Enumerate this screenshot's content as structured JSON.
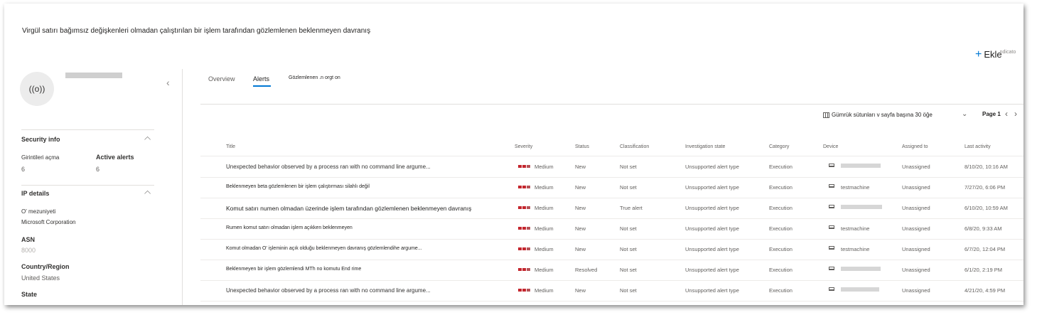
{
  "page": {
    "title": "Virgül satırı bağımsız değişkenleri olmadan çalıştırılan bir işlem tarafından gözlemlenen beklenmeyen davranış",
    "add_label": "Ekle",
    "add_extra": "ndicato"
  },
  "entity": {
    "avatar_glyph": "((o))"
  },
  "security_info": {
    "heading": "Security info",
    "logons_label": "Girintileri açma",
    "logons_value": "6",
    "alerts_label": "Active alerts",
    "alerts_value": "6"
  },
  "ip_details": {
    "heading": "IP details",
    "org_label": "O' mezuniyeti",
    "org_value": "Microsoft Corporation",
    "asn_label": "ASN",
    "asn_value": "8000",
    "country_label": "Country/Region",
    "country_value": "United States",
    "state_label": "State"
  },
  "tabs": [
    "Overview",
    "Alerts",
    "Gözlemlenen .n orgt on"
  ],
  "toolbar": {
    "customize": "Gümrük sütunları v sayfa başına 30 öğe",
    "page": "Page 1"
  },
  "table": {
    "columns": [
      "Title",
      "Severity",
      "Status",
      "Classification",
      "Investigation state",
      "Category",
      "Device",
      "Assigned to",
      "Last activity"
    ],
    "rows": [
      {
        "title": "Unexpected behavior observed by a process ran with no command line argume...",
        "severity": "Medium",
        "status": "New",
        "classification": "Not set",
        "investigation": "Unsupported alert type",
        "category": "Execution",
        "device": "",
        "assigned": "Unassigned",
        "last": "8/10/20, 10:16 AM"
      },
      {
        "title": "Beklenmeyen beta gözlemlenen bir işlem çalıştırması silahlı değil",
        "severity": "Medium",
        "status": "New",
        "classification": "Not set",
        "investigation": "Unsupported alert type",
        "category": "Execution",
        "device": "testmachine",
        "assigned": "Unassigned",
        "last": "7/27/20, 6:06 PM"
      },
      {
        "title": "Komut satırı numen olmadan üzerinde işlem tarafından gözlemlenen beklenmeyen davranış",
        "severity": "Medium",
        "status": "New",
        "classification": "True alert",
        "investigation": "Unsupported alert type",
        "category": "Execution",
        "device": "",
        "assigned": "Unassigned",
        "last": "6/10/20, 10:59 AM"
      },
      {
        "title": "Rumen komut satırı olmadan işlem açıkken beklenmeyen",
        "severity": "Medium",
        "status": "New",
        "classification": "Not set",
        "investigation": "Unsupported alert type",
        "category": "Execution",
        "device": "testmachine",
        "assigned": "Unassigned",
        "last": "6/8/20, 9:33 AM"
      },
      {
        "title": "Komut olmadan O' işleminin açık olduğu beklenmeyen davranış gözlemlendihe argume...",
        "severity": "Medium",
        "status": "New",
        "classification": "Not set",
        "investigation": "Unsupported alert type",
        "category": "Execution",
        "device": "testmachine",
        "assigned": "Unassigned",
        "last": "6/7/20, 12:04 PM"
      },
      {
        "title": "Beklenmeyen bir işlem gözlemlendi MTh no komutu End rime",
        "severity": "Medium",
        "status": "Resolved",
        "classification": "Not set",
        "investigation": "Unsupported alert type",
        "category": "Execution",
        "device": "",
        "assigned": "Unassigned",
        "last": "6/1/20, 2:19 PM"
      },
      {
        "title": "Unexpected behavior observed by a process ran with no command line argume...",
        "severity": "Medium",
        "status": "New",
        "classification": "Not set",
        "investigation": "Unsupported alert type",
        "category": "Execution",
        "device": "",
        "assigned": "Unassigned",
        "last": "4/21/20, 4:59 PM"
      }
    ]
  },
  "colors": {
    "accent": "#0078d4",
    "severity_medium": "#c4262e"
  }
}
